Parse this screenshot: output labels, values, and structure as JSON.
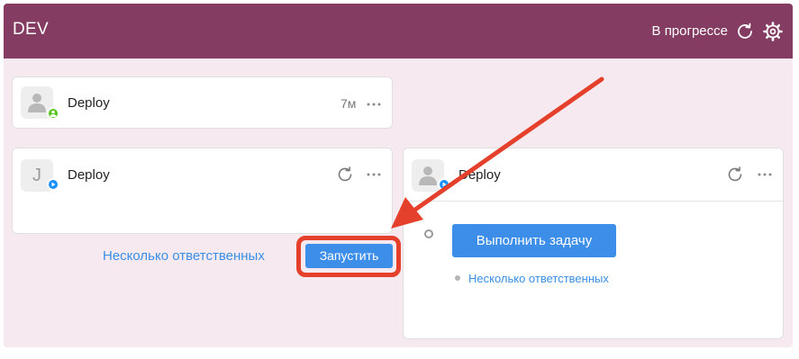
{
  "header": {
    "title": "DEV",
    "status": "В прогрессе",
    "refresh_icon": "refresh-icon",
    "settings_icon": "gear-icon",
    "background_color": "#843c62"
  },
  "cards": {
    "top": {
      "title": "Deploy",
      "time": "7м",
      "avatar_icon": "user-icon",
      "badge_icon": "user-icon",
      "badge_color": "#52c41a"
    },
    "left": {
      "title": "Deploy",
      "avatar_letter": "J",
      "badge_icon": "play-icon",
      "badge_color": "#1890ff"
    },
    "right": {
      "title": "Deploy",
      "avatar_icon": "user-icon",
      "badge_icon": "play-icon",
      "badge_color": "#1890ff",
      "execute_button": "Выполнить задачу",
      "assignees_link": "Несколько ответственных"
    }
  },
  "left_actions": {
    "assignees_link": "Несколько ответственных",
    "start_button": "Запустить"
  },
  "annotation": {
    "color": "#e4402c"
  }
}
